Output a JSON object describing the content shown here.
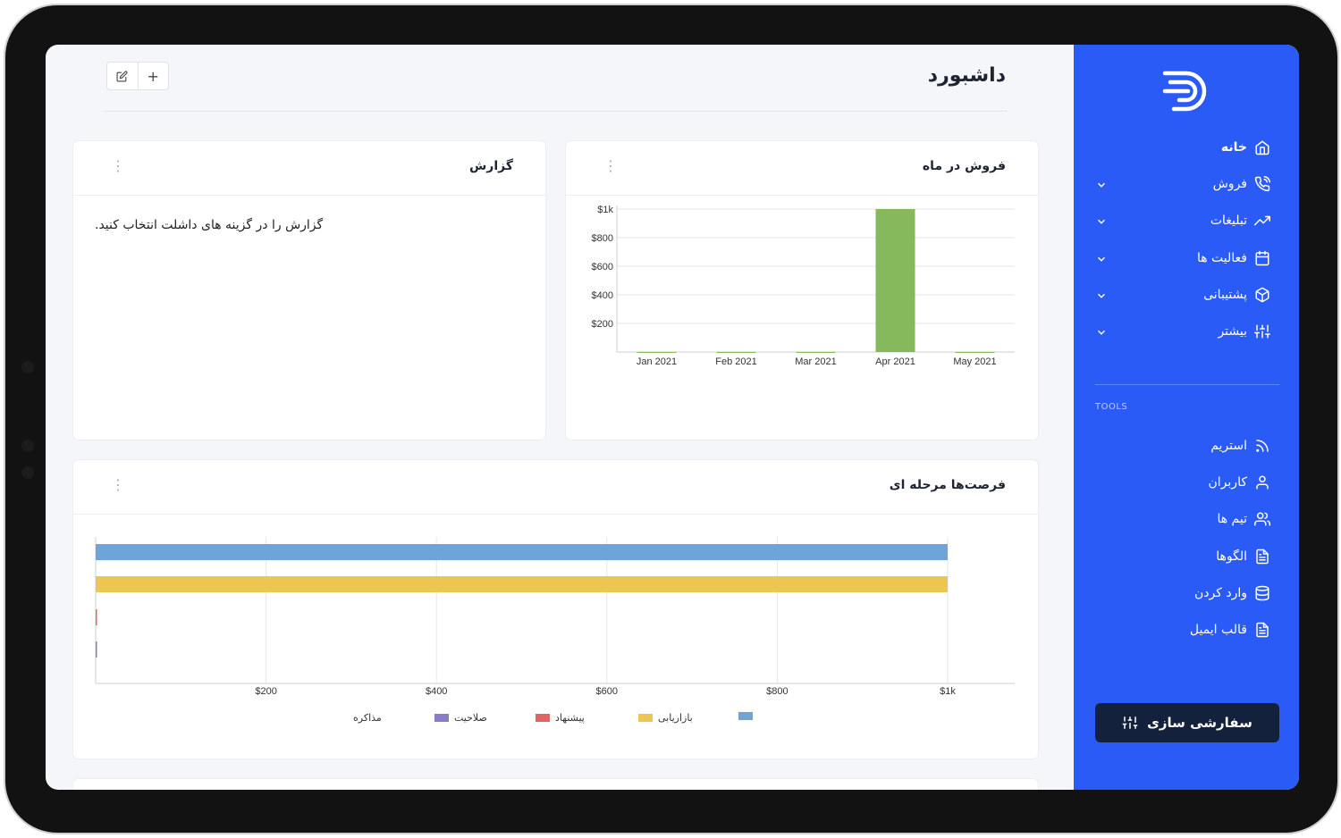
{
  "sidebar": {
    "items": [
      {
        "label": "خانه",
        "icon": "home-icon",
        "active": true
      },
      {
        "label": "فروش",
        "icon": "phone-icon",
        "has_children": true
      },
      {
        "label": "تبلیغات",
        "icon": "trending-up-icon",
        "has_children": true
      },
      {
        "label": "فعالیت ها",
        "icon": "calendar-icon",
        "has_children": true
      },
      {
        "label": "پشتیبانی",
        "icon": "box-icon",
        "has_children": true
      },
      {
        "label": "بیشتر",
        "icon": "sliders-icon",
        "has_children": true
      }
    ],
    "tools_title": "TOOLS",
    "tools": [
      {
        "label": "استریم",
        "icon": "rss-icon"
      },
      {
        "label": "کاربران",
        "icon": "user-icon"
      },
      {
        "label": "تیم ها",
        "icon": "users-icon"
      },
      {
        "label": "الگوها",
        "icon": "file-text-icon"
      },
      {
        "label": "وارد کردن",
        "icon": "database-icon"
      },
      {
        "label": "قالب ایمیل",
        "icon": "file-text-icon"
      }
    ],
    "customize_label": "سفارشی سازی",
    "accent": "#2a5bf6"
  },
  "header": {
    "title": "داشبورد",
    "add_label": "+"
  },
  "report_card": {
    "title": "گزارش",
    "text": "گزارش را در گزینه های داشلت انتخاب کنید."
  },
  "sales_card": {
    "title": "فروش در ماه"
  },
  "pipeline_card": {
    "title": "فرصت‌ها مرحله ای"
  },
  "chart_data": [
    {
      "type": "bar",
      "categories": [
        "Jan 2021",
        "Feb 2021",
        "Mar 2021",
        "Apr 2021",
        "May 2021"
      ],
      "values": [
        0,
        0,
        0,
        1000,
        0
      ],
      "ylim": [
        0,
        1000
      ],
      "yticks": [
        "$200",
        "$400",
        "$600",
        "$800",
        "$1k"
      ],
      "ytick_values": [
        200,
        400,
        600,
        800,
        1000
      ],
      "color": "#86b85c",
      "grid": true
    },
    {
      "type": "bar",
      "orientation": "horizontal",
      "categories": [
        "",
        "بازاریابی",
        "پیشنهاد",
        "صلاحیت",
        "مذاکره"
      ],
      "values": [
        1000,
        1000,
        0,
        0,
        0
      ],
      "colors": [
        "#6fa4d8",
        "#ecc552",
        "#e06464",
        "#8b7bc8",
        "#cfcfcf"
      ],
      "xlim": [
        0,
        1000
      ],
      "xticks": [
        "$200",
        "$400",
        "$600",
        "$800",
        "$1k"
      ],
      "xtick_values": [
        200,
        400,
        600,
        800,
        1000
      ],
      "legend": [
        "",
        "بازاریابی",
        "پیشنهاد",
        "صلاحیت",
        "مذاکره"
      ],
      "legend_position": "bottom",
      "grid": true
    }
  ]
}
